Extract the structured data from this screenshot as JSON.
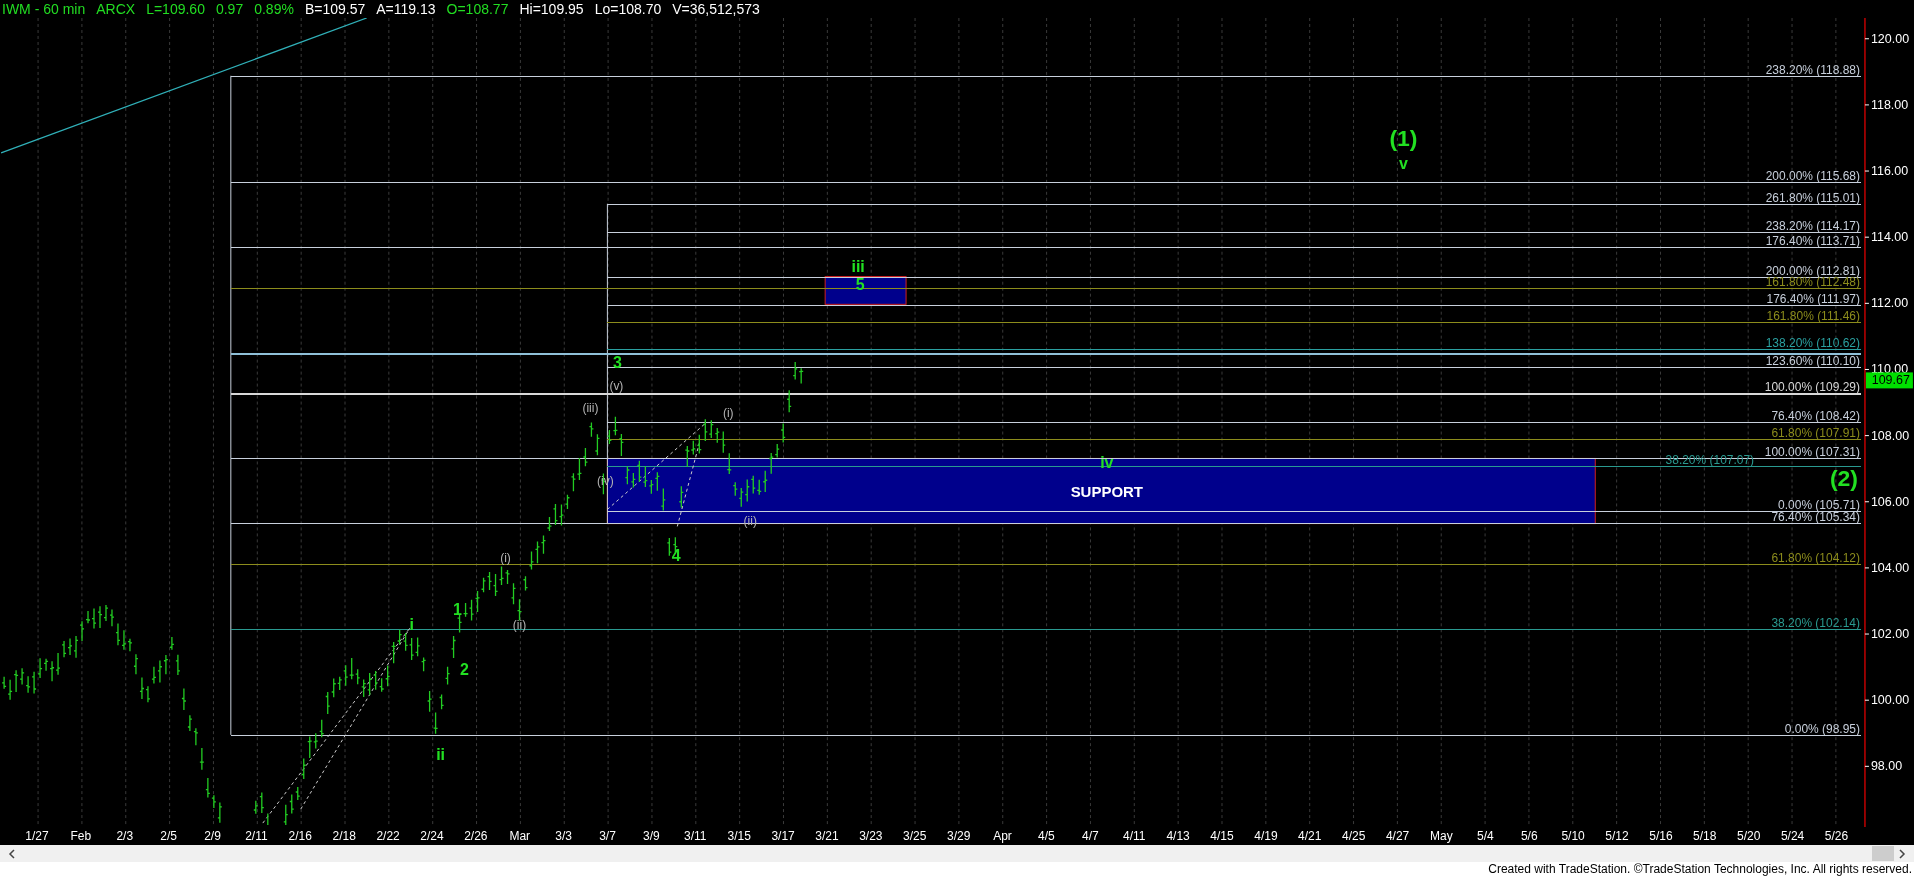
{
  "header": {
    "items": [
      {
        "text": "IWM - 60 min",
        "color": "#22dd22"
      },
      {
        "text": "ARCX",
        "color": "#22dd22"
      },
      {
        "text": "L=109.60",
        "color": "#22dd22"
      },
      {
        "text": "0.97",
        "color": "#22dd22"
      },
      {
        "text": "0.89%",
        "color": "#22dd22"
      },
      {
        "text": "B=109.57",
        "color": "#ffffff"
      },
      {
        "text": "A=119.13",
        "color": "#ffffff"
      },
      {
        "text": "O=108.77",
        "color": "#22dd22"
      },
      {
        "text": "Hi=109.95",
        "color": "#ffffff"
      },
      {
        "text": "Lo=108.70",
        "color": "#ffffff"
      },
      {
        "text": "V=36,512,573",
        "color": "#ffffff"
      }
    ]
  },
  "chart": {
    "fib_levels": [
      {
        "label": "238.20% (118.88)",
        "color": "#c8d0dc"
      },
      {
        "label": "200.00% (115.68)",
        "color": "#c8d0dc"
      },
      {
        "label": "261.80% (115.01)",
        "color": "#c8d0dc"
      },
      {
        "label": "238.20% (114.17)",
        "color": "#c8d0dc"
      },
      {
        "label": "176.40% (113.71)",
        "color": "#c8d0dc"
      },
      {
        "label": "200.00% (112.81)",
        "color": "#c8d0dc"
      },
      {
        "label": "161.80% (112.48)",
        "color": "#8c8c1c"
      },
      {
        "label": "176.40% (111.97)",
        "color": "#c8d0dc"
      },
      {
        "label": "161.80% (111.46)",
        "color": "#8c8c1c"
      },
      {
        "label": "138.20% (110.62)",
        "color": "#2aa0a0"
      },
      {
        "color": "#8fc0d8"
      },
      {
        "label": "123.60% (110.10)",
        "color": "#c8d0dc"
      },
      {
        "label": "100.00% (109.29)",
        "color": "#d8d8d8"
      },
      {
        "label": "76.40% (108.42)",
        "color": "#c8d0dc"
      },
      {
        "label": "61.80% (107.91)",
        "color": "#8c8c1c"
      },
      {
        "label": "100.00% (107.31)",
        "color": "#c8d0dc"
      },
      {
        "label": "38.20% (107.07)",
        "color": "#2a9a90"
      },
      {
        "label": "0.00% (105.71)",
        "color": "#c8d0dc"
      },
      {
        "label": "76.40% (105.34)",
        "color": "#c8d0dc"
      },
      {
        "label": "61.80% (104.12)",
        "color": "#8c8c1c"
      },
      {
        "label": "38.20% (102.14)",
        "color": "#2a9a90"
      },
      {
        "label": "0.00% (98.95)",
        "color": "#c8d0dc"
      }
    ],
    "zones": [
      {
        "kind": "support",
        "label": "SUPPORT"
      },
      {
        "kind": "target"
      }
    ],
    "wave_labels": [
      {
        "text": "i",
        "kind": "major"
      },
      {
        "text": "1",
        "kind": "major"
      },
      {
        "text": "2",
        "kind": "major"
      },
      {
        "text": "ii",
        "kind": "major"
      },
      {
        "text": "(i)",
        "kind": "minor"
      },
      {
        "text": "(ii)",
        "kind": "minor"
      },
      {
        "text": "(iii)",
        "kind": "minor"
      },
      {
        "text": "(iv)",
        "kind": "minor"
      },
      {
        "text": "(v)",
        "kind": "minor"
      },
      {
        "text": "3",
        "kind": "major"
      },
      {
        "text": "4",
        "kind": "major"
      },
      {
        "text": "(i)",
        "kind": "minor"
      },
      {
        "text": "(ii)",
        "kind": "minor"
      },
      {
        "text": "iii",
        "kind": "major"
      },
      {
        "text": "5",
        "kind": "major"
      },
      {
        "text": "iv",
        "kind": "major"
      },
      {
        "text": "v",
        "kind": "major"
      },
      {
        "text": "(1)",
        "kind": "degree"
      },
      {
        "text": "(2)",
        "kind": "degree"
      }
    ],
    "price_axis": {
      "ticks": [
        "120.00",
        "118.00",
        "116.00",
        "114.00",
        "112.00",
        "110.00",
        "108.00",
        "106.00",
        "104.00",
        "102.00",
        "100.00",
        "98.00"
      ],
      "last_price": "109.67"
    },
    "date_axis": {
      "labels": [
        "1/27",
        "Feb",
        "2/3",
        "2/5",
        "2/9",
        "2/11",
        "2/16",
        "2/18",
        "2/22",
        "2/24",
        "2/26",
        "Mar",
        "3/3",
        "3/7",
        "3/9",
        "3/11",
        "3/15",
        "3/17",
        "3/21",
        "3/23",
        "3/25",
        "3/29",
        "Apr",
        "4/5",
        "4/7",
        "4/11",
        "4/13",
        "4/15",
        "4/19",
        "4/21",
        "4/25",
        "4/27",
        "May",
        "5/4",
        "5/6",
        "5/10",
        "5/12",
        "5/16",
        "5/18",
        "5/20",
        "5/24",
        "5/26"
      ]
    }
  },
  "footer": {
    "text": "Created with TradeStation. ©TradeStation Technologies, Inc. All rights reserved."
  }
}
